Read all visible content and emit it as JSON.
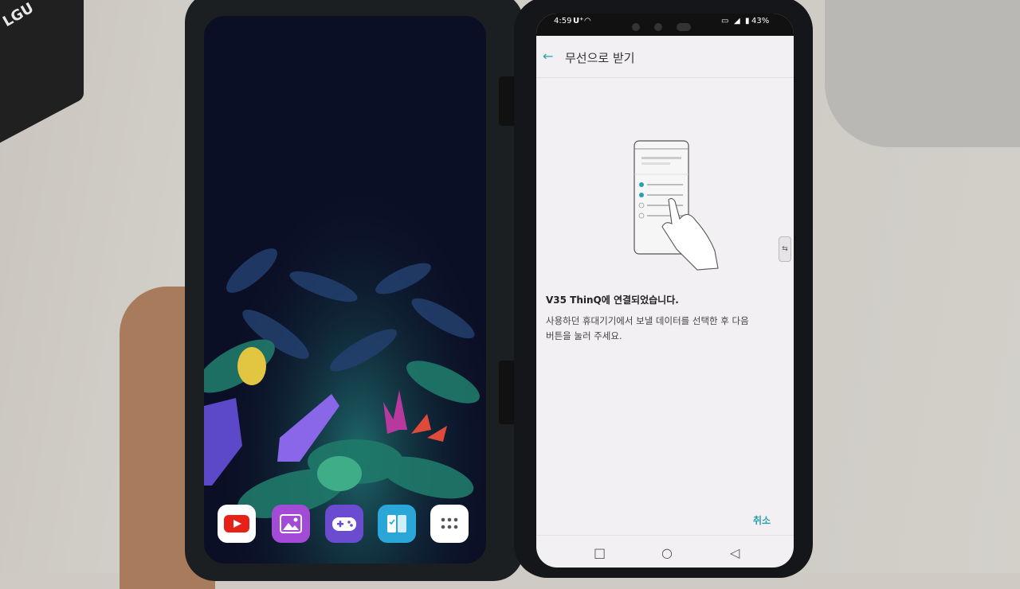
{
  "right_phone": {
    "status_bar": {
      "time": "4:59",
      "carrier": "U⁺",
      "battery": "43%"
    },
    "app_bar": {
      "title": "무선으로 받기"
    },
    "message": {
      "headline": "V35 ThinQ에 연결되었습니다.",
      "line1": "사용하던 휴대기기에서 보낼 데이터를 선택한 후 다음",
      "line2": "버튼을 눌러 주세요."
    },
    "cancel_label": "취소"
  },
  "background": {
    "box_logo": "LGU"
  },
  "left_phone": {
    "dock_apps": [
      {
        "name": "youtube-icon",
        "color": "#ffffff"
      },
      {
        "name": "gallery-icon",
        "color": "#a34bd6"
      },
      {
        "name": "game-icon",
        "color": "#6b4bd0"
      },
      {
        "name": "dual-screen-icon",
        "color": "#2aa7d8"
      },
      {
        "name": "app-drawer-icon",
        "color": "#ffffff"
      }
    ]
  },
  "colors": {
    "accent": "#2a9fb2"
  }
}
